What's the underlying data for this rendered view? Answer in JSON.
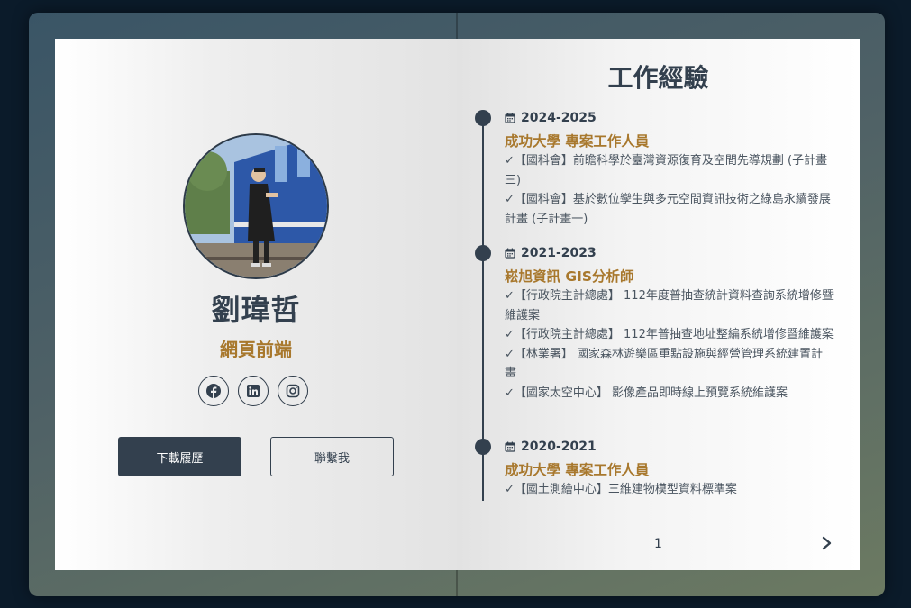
{
  "profile": {
    "name": "劉瑋哲",
    "role": "網頁前端",
    "socials": [
      {
        "icon": "facebook-icon"
      },
      {
        "icon": "linkedin-icon"
      },
      {
        "icon": "instagram-icon"
      }
    ],
    "download_label": "下載履歷",
    "contact_label": "聯繫我"
  },
  "experience": {
    "title": "工作經驗",
    "entries": [
      {
        "years": "2024-2025",
        "job": "成功大學 專案工作人員",
        "items": [
          "✓【國科會】前瞻科學於臺灣資源復育及空間先導規劃 (子計畫三)",
          "✓【國科會】基於數位孿生與多元空間資訊技術之綠島永續發展計畫 (子計畫一)"
        ]
      },
      {
        "years": "2021-2023",
        "job": "崧旭資訊 GIS分析師",
        "items": [
          "✓【行政院主計總處】 112年度普抽查統計資料查詢系統增修暨維護案",
          "✓【行政院主計總處】 112年普抽查地址整編系統增修暨維護案",
          "✓【林業署】 國家森林遊樂區重點設施與經營管理系統建置計畫",
          "✓【國家太空中心】 影像產品即時線上預覽系統維護案"
        ]
      },
      {
        "years": "2020-2021",
        "job": "成功大學 專案工作人員",
        "items": [
          "✓【國土測繪中心】三維建物模型資料標準案"
        ]
      }
    ]
  },
  "pagination": {
    "page": "1"
  },
  "colors": {
    "accent": "#a8782d",
    "dark": "#33404e",
    "background": "#0b1b2a"
  }
}
